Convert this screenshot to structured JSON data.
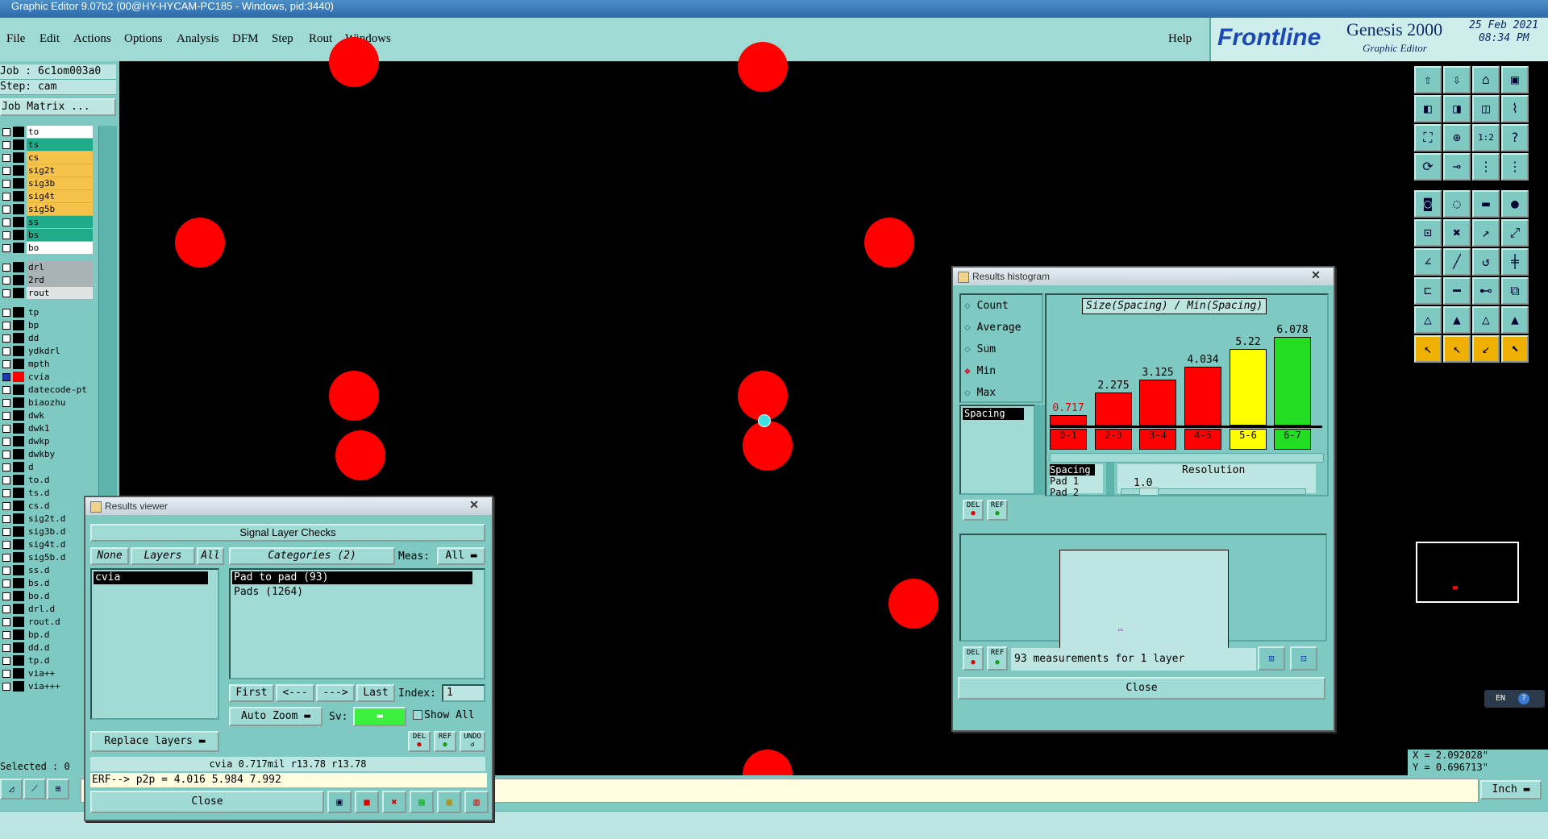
{
  "window_title": "Graphic Editor 9.07b2 (00@HY-HYCAM-PC185 - Windows, pid:3440)",
  "menu": [
    "File",
    "Edit",
    "Actions",
    "Options",
    "Analysis",
    "DFM",
    "Step",
    "Rout",
    "Windows"
  ],
  "help": "Help",
  "brand": {
    "logo": "Frontline",
    "product": "Genesis 2000",
    "subtitle": "Graphic Editor",
    "date": "25 Feb 2021",
    "time": "08:34 PM"
  },
  "job": {
    "job_line": "Job : 6c1om003a0",
    "step_line": "Step: cam",
    "matrix_button": "Job Matrix ..."
  },
  "layers": [
    {
      "name": "to",
      "color": "#ffffff",
      "sw": "#000000"
    },
    {
      "name": "ts",
      "color": "#1faa8a",
      "sw": "#000000"
    },
    {
      "name": "cs",
      "color": "#f5c24a",
      "sw": "#000000"
    },
    {
      "name": "sig2t",
      "color": "#f5c24a",
      "sw": "#000000"
    },
    {
      "name": "sig3b",
      "color": "#f5c24a",
      "sw": "#000000"
    },
    {
      "name": "sig4t",
      "color": "#f5c24a",
      "sw": "#000000"
    },
    {
      "name": "sig5b",
      "color": "#f5c24a",
      "sw": "#000000"
    },
    {
      "name": "ss",
      "color": "#1faa8a",
      "sw": "#000000"
    },
    {
      "name": "bs",
      "color": "#1faa8a",
      "sw": "#000000"
    },
    {
      "name": "bo",
      "color": "#ffffff",
      "sw": "#000000"
    },
    {
      "name": "drl",
      "color": "#a9b3b6",
      "sw": "#000000"
    },
    {
      "name": "2rd",
      "color": "#a9b3b6",
      "sw": "#000000"
    },
    {
      "name": "rout",
      "color": "#dfe3e3",
      "sw": "#000000"
    },
    {
      "name": "tp",
      "color": "#7fc9c3",
      "sw": "#000000"
    },
    {
      "name": "bp",
      "color": "#7fc9c3",
      "sw": "#000000"
    },
    {
      "name": "dd",
      "color": "#7fc9c3",
      "sw": "#000000"
    },
    {
      "name": "ydkdrl",
      "color": "#7fc9c3",
      "sw": "#000000"
    },
    {
      "name": "mpth",
      "color": "#7fc9c3",
      "sw": "#000000"
    },
    {
      "name": "cvia",
      "color": "#7fc9c3",
      "sw": "#ff0000"
    },
    {
      "name": "datecode-pt",
      "color": "#7fc9c3",
      "sw": "#000000"
    },
    {
      "name": "biaozhu",
      "color": "#7fc9c3",
      "sw": "#000000"
    },
    {
      "name": "dwk",
      "color": "#7fc9c3",
      "sw": "#000000"
    },
    {
      "name": "dwk1",
      "color": "#7fc9c3",
      "sw": "#000000"
    },
    {
      "name": "dwkp",
      "color": "#7fc9c3",
      "sw": "#000000"
    },
    {
      "name": "dwkby",
      "color": "#7fc9c3",
      "sw": "#000000"
    },
    {
      "name": "d",
      "color": "#7fc9c3",
      "sw": "#000000"
    },
    {
      "name": "to.d",
      "color": "#7fc9c3",
      "sw": "#000000"
    },
    {
      "name": "ts.d",
      "color": "#7fc9c3",
      "sw": "#000000"
    },
    {
      "name": "cs.d",
      "color": "#7fc9c3",
      "sw": "#000000"
    },
    {
      "name": "sig2t.d",
      "color": "#7fc9c3",
      "sw": "#000000"
    },
    {
      "name": "sig3b.d",
      "color": "#7fc9c3",
      "sw": "#000000"
    },
    {
      "name": "sig4t.d",
      "color": "#7fc9c3",
      "sw": "#000000"
    },
    {
      "name": "sig5b.d",
      "color": "#7fc9c3",
      "sw": "#000000"
    },
    {
      "name": "ss.d",
      "color": "#7fc9c3",
      "sw": "#000000"
    },
    {
      "name": "bs.d",
      "color": "#7fc9c3",
      "sw": "#000000"
    },
    {
      "name": "bo.d",
      "color": "#7fc9c3",
      "sw": "#000000"
    },
    {
      "name": "drl.d",
      "color": "#7fc9c3",
      "sw": "#000000"
    },
    {
      "name": "rout.d",
      "color": "#7fc9c3",
      "sw": "#000000"
    },
    {
      "name": "bp.d",
      "color": "#7fc9c3",
      "sw": "#000000"
    },
    {
      "name": "dd.d",
      "color": "#7fc9c3",
      "sw": "#000000"
    },
    {
      "name": "tp.d",
      "color": "#7fc9c3",
      "sw": "#000000"
    },
    {
      "name": "via++",
      "color": "#7fc9c3",
      "sw": "#000000"
    },
    {
      "name": "via+++",
      "color": "#7fc9c3",
      "sw": "#000000"
    }
  ],
  "selected": "Selected : 0",
  "results_viewer": {
    "title": "Results viewer",
    "header": "Signal Layer Checks",
    "none": "None",
    "layers": "Layers",
    "all": "All",
    "categories": "Categories (2)",
    "meas_label": "Meas:",
    "meas_value": "All",
    "layer_list": [
      "cvia"
    ],
    "category_list": [
      "Pad to pad (93)",
      "Pads (1264)"
    ],
    "first": "First",
    "prev": "<---",
    "next": "--->",
    "last": "Last",
    "index_label": "Index:",
    "index_value": "1",
    "auto_zoom": "Auto Zoom",
    "sv": "Sv:",
    "show_all": "Show All",
    "replace_layers": "Replace layers",
    "del": "DEL",
    "ref": "REF",
    "undo": "UNDO",
    "info": "cvia 0.717mil  r13.78  r13.78",
    "close": "Close"
  },
  "command_line": "ERF--> p2p = 4.016 5.984 7.992",
  "histogram": {
    "title": "Results histogram",
    "options": [
      "Count",
      "Average",
      "Sum",
      "Min",
      "Max"
    ],
    "selected_option": "Min",
    "chart_title": "Size(Spacing) / Min(Spacing)",
    "list_label": "Spacing",
    "info_labels": [
      "Spacing",
      "Pad 1",
      "Pad 2"
    ],
    "resolution_label": "Resolution",
    "resolution_value": "1.0",
    "summary": "93 measurements for 1 layer",
    "close": "Close",
    "del": "DEL",
    "ref": "REF"
  },
  "chart_data": {
    "type": "bar",
    "title": "Size(Spacing) / Min(Spacing)",
    "categories": [
      "0-1",
      "2-3",
      "3-4",
      "4-5",
      "5-6",
      "6-7"
    ],
    "values": [
      0.717,
      2.275,
      3.125,
      4.034,
      5.22,
      6.078
    ],
    "colors": [
      "#ff0000",
      "#ff0000",
      "#ff0000",
      "#ff0000",
      "#ffff00",
      "#22dd22"
    ],
    "ylim": [
      0,
      6.5
    ]
  },
  "coords": {
    "x": "X = 2.092028\"",
    "y": "Y = 0.696713\""
  },
  "units": "Inch",
  "ime": "EN"
}
